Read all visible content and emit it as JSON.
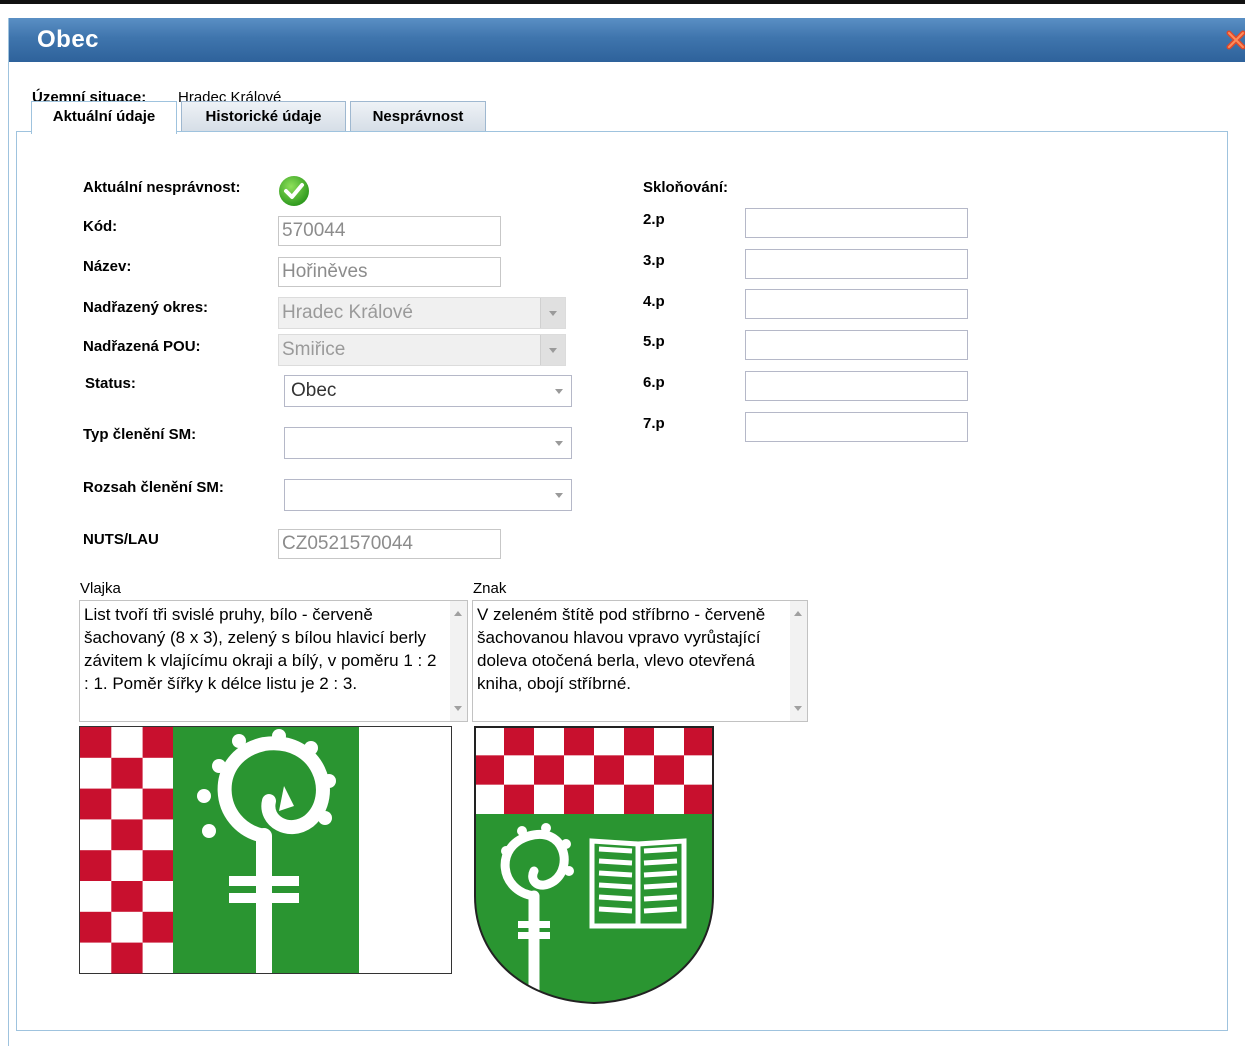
{
  "dialog": {
    "title": "Obec"
  },
  "territorial": {
    "label": "Územní situace:",
    "value": "Hradec Králové"
  },
  "tabs": [
    {
      "label": "Aktuální údaje",
      "active": true
    },
    {
      "label": "Historické údaje",
      "active": false
    },
    {
      "label": "Nesprávnost",
      "active": false
    }
  ],
  "form": {
    "nespravnost_label": "Aktuální nesprávnost:",
    "kod_label": "Kód:",
    "kod_value": "570044",
    "nazev_label": "Název:",
    "nazev_value": "Hořiněves",
    "okres_label": "Nadřazený okres:",
    "okres_value": "Hradec Králové",
    "pou_label": "Nadřazená POU:",
    "pou_value": "Smiřice",
    "status_label": "Status:",
    "status_value": "Obec",
    "typ_label": "Typ členění SM:",
    "typ_value": "",
    "rozsah_label": "Rozsah členění SM:",
    "rozsah_value": "",
    "nuts_label": "NUTS/LAU",
    "nuts_value": "CZ0521570044"
  },
  "sklonovani": {
    "label": "Skloňování:",
    "cases": [
      {
        "label": "2.p",
        "value": ""
      },
      {
        "label": "3.p",
        "value": ""
      },
      {
        "label": "4.p",
        "value": ""
      },
      {
        "label": "5.p",
        "value": ""
      },
      {
        "label": "6.p",
        "value": ""
      },
      {
        "label": "7.p",
        "value": ""
      }
    ]
  },
  "vlajka": {
    "label": "Vlajka",
    "text": "List tvoří tři svislé pruhy, bílo - červeně šachovaný (8 x 3), zelený s bílou hlavicí berly závitem k vlajícímu okraji a bílý, v poměru 1 : 2 : 1. Poměr šířky k délce listu je 2 : 3."
  },
  "znak": {
    "label": "Znak",
    "text": "V zeleném štítě pod stříbrno - červeně šachovanou hlavou vpravo vyrůstající doleva otočená berla, vlevo otevřená kniha, obojí stříbrné."
  },
  "colors": {
    "green": "#2a9531",
    "red": "#c8102e",
    "titlebar": "#3f75ad",
    "border": "#9fc3de"
  }
}
